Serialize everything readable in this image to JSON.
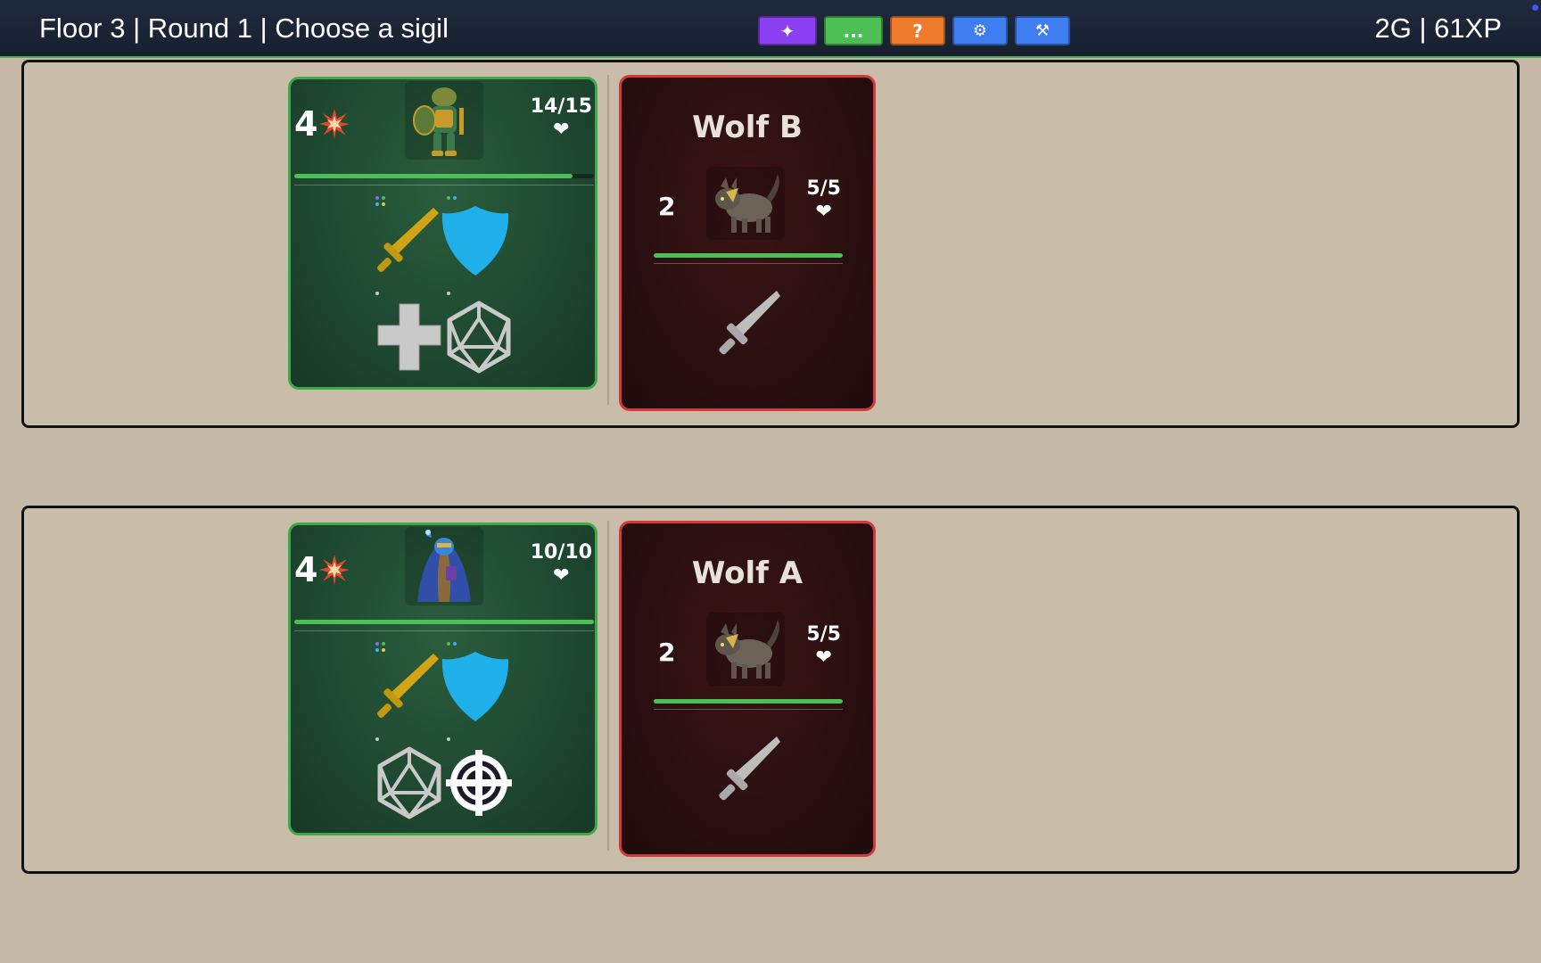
{
  "topbar": {
    "status": "Floor 3 | Round 1 | Choose a sigil",
    "resources": "2G | 61XP",
    "buttons": [
      {
        "label": "✦",
        "color": "#8a3ff0",
        "icon": "sparkle-icon"
      },
      {
        "label": "...",
        "color": "#4cbf55",
        "icon": "more-icon"
      },
      {
        "label": "?",
        "color": "#ee7a2c",
        "icon": "help-icon"
      },
      {
        "label": "⚙",
        "color": "#3f7ef0",
        "icon": "gear-icon"
      },
      {
        "label": "⚒",
        "color": "#3f7ef0",
        "icon": "tools-icon"
      }
    ]
  },
  "rows": [
    {
      "hero": {
        "attack": "4",
        "hp": "14/15",
        "hp_fraction": 0.93,
        "portrait": "armored-frog-knight",
        "actions_top": [
          "sword-icon",
          "shield-icon"
        ],
        "actions_bottom": [
          "heal-cross-icon",
          "d20-die-icon"
        ]
      },
      "enemy": {
        "name": "Wolf B",
        "attack": "2",
        "hp": "5/5",
        "hp_fraction": 1.0,
        "portrait": "wolf",
        "action": "sword-icon"
      }
    },
    {
      "hero": {
        "attack": "4",
        "hp": "10/10",
        "hp_fraction": 1.0,
        "portrait": "blue-robed-mage",
        "actions_top": [
          "sword-icon",
          "shield-icon"
        ],
        "actions_bottom": [
          "d20-die-icon",
          "crosshair-icon"
        ]
      },
      "enemy": {
        "name": "Wolf A",
        "attack": "2",
        "hp": "5/5",
        "hp_fraction": 1.0,
        "portrait": "wolf",
        "action": "sword-icon"
      }
    }
  ],
  "heart_glyph": "❤"
}
